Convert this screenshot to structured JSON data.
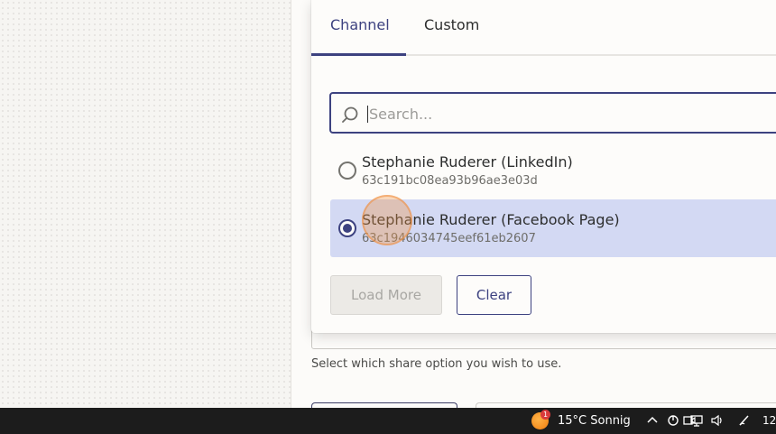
{
  "tabs": {
    "channel": "Channel",
    "custom": "Custom"
  },
  "search": {
    "placeholder": "Search..."
  },
  "options": [
    {
      "title": "Stephanie Ruderer (LinkedIn)",
      "id": "63c191bc08ea93b96ae3e03d",
      "selected": false
    },
    {
      "title": "Stephanie Ruderer (Facebook Page)",
      "id": "63c1946034745eef61eb2607",
      "selected": true
    }
  ],
  "buttons": {
    "load_more": "Load More",
    "clear": "Clear"
  },
  "field": {
    "help_text": "Select which share option you wish to use."
  },
  "taskbar": {
    "weather_badge": "1",
    "weather": "15°C  Sonnig",
    "clock": "12:"
  },
  "colors": {
    "accent": "#3d4280",
    "selected_bg": "#d3d9f3",
    "taskbar_bg": "#1c1c1c"
  }
}
